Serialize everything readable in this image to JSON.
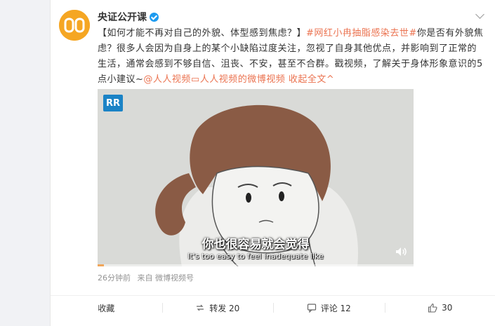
{
  "post": {
    "author": "央证公开课",
    "text_lead": "【如何才能不再对自己的外貌、体型感到焦虑？】",
    "topic": "#网红小冉抽脂感染去世#",
    "text_body": "你是否有外貌焦虑？很多人会因为自身上的某个小缺陷过度关注，忽视了自身其他优点，并影响到了正常的生活，通常会感到不够自信、沮丧、不安，甚至不合群。戳视频，了解关于身体形象意识的5点小建议~",
    "mention": "@人人视频",
    "video_link": "人人视频的微博视频",
    "collapse": "收起全文",
    "time": "26分钟前",
    "source": "来自 微博视频号"
  },
  "video": {
    "logo": "RR",
    "subtitle_zh": "你也很容易就会觉得",
    "subtitle_en": "It's too easy to feel inadequate like",
    "progress": 0.02,
    "progress_color": "#f0a65a"
  },
  "actions": {
    "favorite": "收藏",
    "repost": "转发 20",
    "comment": "评论 12",
    "like": "30"
  }
}
